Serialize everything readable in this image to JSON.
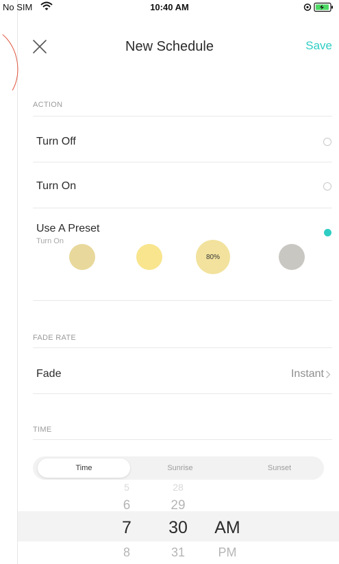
{
  "status_bar": {
    "carrier": "No SIM",
    "time": "10:40 AM"
  },
  "nav": {
    "title": "New Schedule",
    "save_label": "Save"
  },
  "action": {
    "header": "ACTION",
    "options": [
      {
        "label": "Turn Off",
        "selected": false
      },
      {
        "label": "Turn On",
        "selected": false
      },
      {
        "label": "Use A Preset",
        "sublabel": "Turn On",
        "selected": true
      }
    ],
    "presets": [
      {
        "color": "#e8d89b",
        "label": ""
      },
      {
        "color": "#f8e58e",
        "label": ""
      },
      {
        "color": "#f2e29d",
        "label": "80%"
      },
      {
        "color": "#c9c7c2",
        "label": ""
      }
    ]
  },
  "fade_rate": {
    "header": "FADE RATE",
    "label": "Fade",
    "value": "Instant"
  },
  "time": {
    "header": "TIME",
    "tabs": [
      "Time",
      "Sunrise",
      "Sunset"
    ],
    "active_tab": "Time",
    "picker": {
      "hours": [
        "5",
        "6",
        "7",
        "8"
      ],
      "minutes": [
        "28",
        "29",
        "30",
        "31"
      ],
      "period": [
        "AM",
        "PM"
      ],
      "selected": {
        "hour": "7",
        "minute": "30",
        "period": "AM"
      }
    }
  },
  "colors": {
    "accent": "#2ecdc3"
  }
}
